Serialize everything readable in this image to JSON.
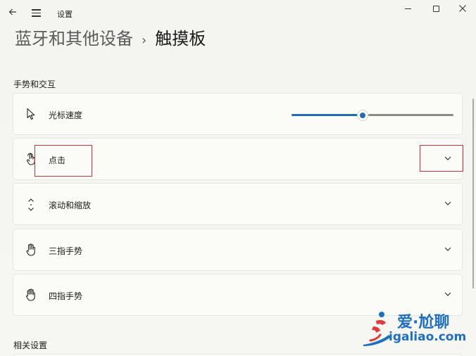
{
  "window": {
    "title": "设置",
    "back_icon": "back-arrow-icon",
    "menu_icon": "hamburger-icon",
    "minimize_icon": "minimize-icon",
    "maximize_icon": "maximize-icon",
    "close_icon": "close-icon"
  },
  "breadcrumb": {
    "parent": "蓝牙和其他设备",
    "separator": "›",
    "current": "触摸板"
  },
  "sections": {
    "gestures": "手势和交互",
    "related": "相关设置"
  },
  "rows": [
    {
      "label": "光标速度",
      "icon": "cursor-icon",
      "control": "slider",
      "slider_value_fraction": 0.44
    },
    {
      "label": "点击",
      "icon": "tap-hand-icon",
      "control": "expand"
    },
    {
      "label": "滚动和缩放",
      "icon": "scroll-arrows-icon",
      "control": "expand"
    },
    {
      "label": "三指手势",
      "icon": "three-finger-hand-icon",
      "control": "expand"
    },
    {
      "label": "四指手势",
      "icon": "four-finger-hand-icon",
      "control": "expand"
    }
  ],
  "watermark": {
    "brand": "爱·尬聊",
    "url": "igaliao.com"
  },
  "colors": {
    "accent": "#1e6bb8",
    "highlight": "#d0303c",
    "watermark": "#1f6fc0"
  }
}
